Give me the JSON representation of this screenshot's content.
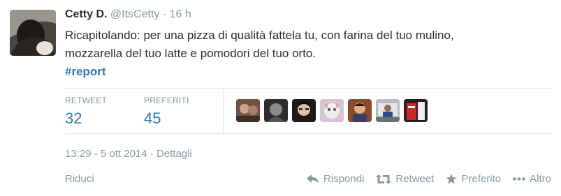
{
  "tweet": {
    "author_name": "Cetty D.",
    "author_handle": "@ItsCetty",
    "separator": "·",
    "time_ago": "16 h",
    "text_line1": "Ricapitolando: per una pizza di qualità fattela tu, con farina del tuo mulino,",
    "text_line2": "mozzarella del tuo latte e pomodori del tuo orto.",
    "hashtag": "#report"
  },
  "stats": {
    "retweet_label": "RETWEET",
    "retweet_count": "32",
    "favorites_label": "PREFERITI",
    "favorites_count": "45"
  },
  "favoriters": [
    {
      "icon": "avatar-1"
    },
    {
      "icon": "avatar-2"
    },
    {
      "icon": "avatar-3"
    },
    {
      "icon": "avatar-4"
    },
    {
      "icon": "avatar-5"
    },
    {
      "icon": "avatar-6"
    },
    {
      "icon": "avatar-7"
    }
  ],
  "meta": {
    "datetime": "13:29 - 5 ott 2014",
    "separator": "·",
    "details_link": "Dettagli"
  },
  "footer": {
    "collapse_label": "Riduci",
    "reply_label": "Rispondi",
    "retweet_label": "Retweet",
    "favorite_label": "Preferito",
    "more_label": "Altro"
  },
  "colors": {
    "link": "#2b7bb9",
    "muted": "#8899a6",
    "text": "#292f33",
    "divider": "#e1e8ed"
  }
}
